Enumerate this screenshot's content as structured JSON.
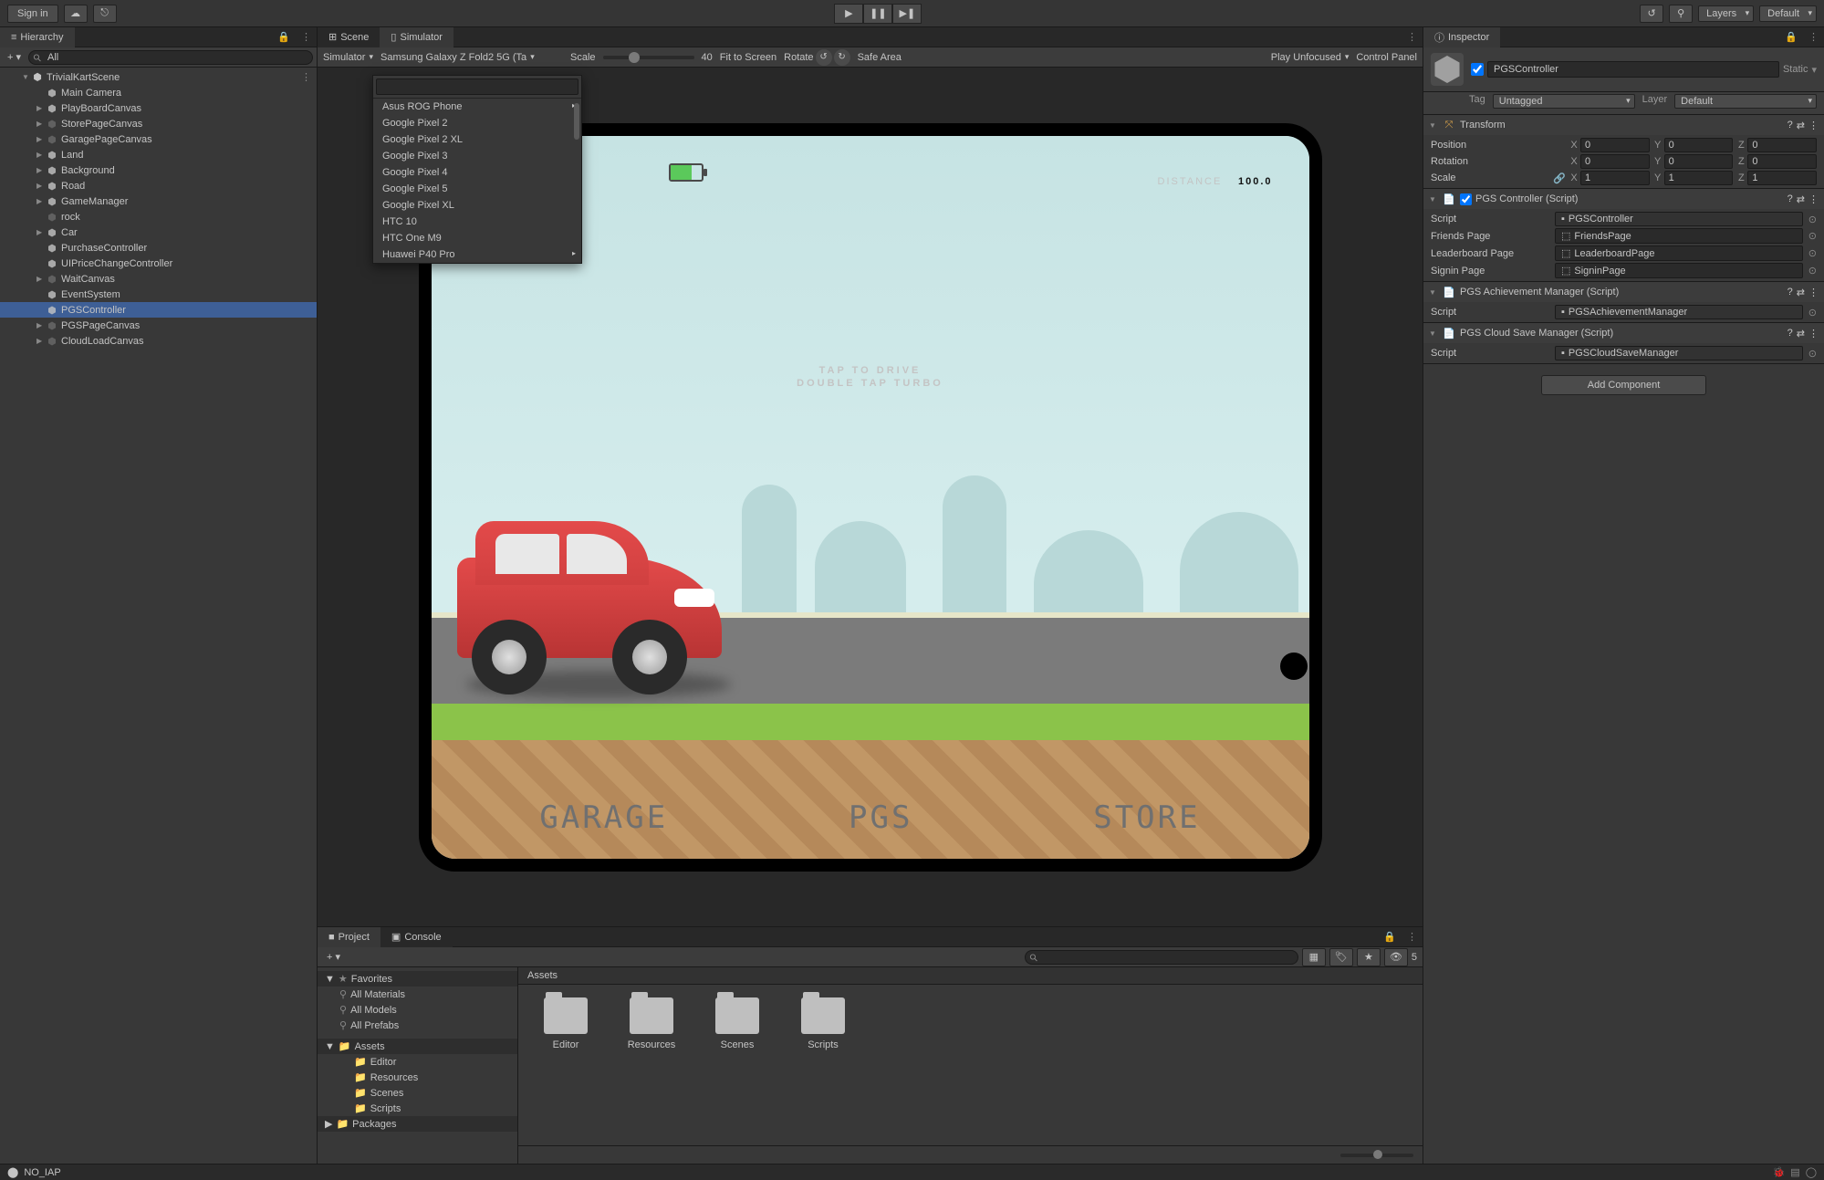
{
  "toolbar": {
    "sign_in": "Sign in",
    "layers": "Layers",
    "layout": "Default"
  },
  "hierarchy": {
    "title": "Hierarchy",
    "search_placeholder": "All",
    "root": "TrivialKartScene",
    "items": [
      {
        "name": "Main Camera",
        "dim": false
      },
      {
        "name": "PlayBoardCanvas",
        "dim": false,
        "exp": true
      },
      {
        "name": "StorePageCanvas",
        "dim": true,
        "exp": true
      },
      {
        "name": "GaragePageCanvas",
        "dim": true,
        "exp": true
      },
      {
        "name": "Land",
        "dim": false,
        "exp": true
      },
      {
        "name": "Background",
        "dim": false,
        "exp": true
      },
      {
        "name": "Road",
        "dim": false,
        "exp": true
      },
      {
        "name": "GameManager",
        "dim": false,
        "exp": true
      },
      {
        "name": "rock",
        "dim": true
      },
      {
        "name": "Car",
        "dim": false,
        "exp": true
      },
      {
        "name": "PurchaseController",
        "dim": false
      },
      {
        "name": "UIPriceChangeController",
        "dim": false
      },
      {
        "name": "WaitCanvas",
        "dim": true,
        "exp": true
      },
      {
        "name": "EventSystem",
        "dim": false
      },
      {
        "name": "PGSController",
        "dim": false,
        "selected": true
      },
      {
        "name": "PGSPageCanvas",
        "dim": true,
        "exp": true
      },
      {
        "name": "CloudLoadCanvas",
        "dim": true,
        "exp": true
      }
    ]
  },
  "tabs": {
    "scene": "Scene",
    "simulator": "Simulator"
  },
  "simulator": {
    "mode": "Simulator",
    "device": "Samsung Galaxy Z Fold2 5G (Ta",
    "scale_label": "Scale",
    "scale_value": "40",
    "fit": "Fit to Screen",
    "rotate": "Rotate",
    "safe": "Safe Area",
    "play_unfocused": "Play Unfocused",
    "control_panel": "Control Panel",
    "device_list": [
      "Asus ROG Phone",
      "Google Pixel 2",
      "Google Pixel 2 XL",
      "Google Pixel 3",
      "Google Pixel 4",
      "Google Pixel 5",
      "Google Pixel XL",
      "HTC 10",
      "HTC One M9",
      "Huawei P40 Pro"
    ]
  },
  "game": {
    "distance_label": "DISTANCE",
    "distance_value": "100.0",
    "line1": "TAP TO DRIVE",
    "line2": "DOUBLE TAP TURBO",
    "btn_garage": "GARAGE",
    "btn_pgs": "PGS",
    "btn_store": "STORE"
  },
  "inspector": {
    "title": "Inspector",
    "name": "PGSController",
    "static": "Static",
    "tag_label": "Tag",
    "tag_value": "Untagged",
    "layer_label": "Layer",
    "layer_value": "Default",
    "transform": {
      "title": "Transform",
      "position": "Position",
      "rotation": "Rotation",
      "scale": "Scale",
      "pos": {
        "x": "0",
        "y": "0",
        "z": "0"
      },
      "rot": {
        "x": "0",
        "y": "0",
        "z": "0"
      },
      "scl": {
        "x": "1",
        "y": "1",
        "z": "1"
      }
    },
    "comp1": {
      "title": "PGS Controller (Script)",
      "script_lbl": "Script",
      "script_val": "PGSController",
      "friends_lbl": "Friends Page",
      "friends_val": "FriendsPage",
      "leader_lbl": "Leaderboard Page",
      "leader_val": "LeaderboardPage",
      "signin_lbl": "Signin Page",
      "signin_val": "SigninPage"
    },
    "comp2": {
      "title": "PGS Achievement Manager (Script)",
      "script_lbl": "Script",
      "script_val": "PGSAchievementManager"
    },
    "comp3": {
      "title": "PGS Cloud Save Manager (Script)",
      "script_lbl": "Script",
      "script_val": "PGSCloudSaveManager"
    },
    "add_component": "Add Component"
  },
  "project": {
    "tab_project": "Project",
    "tab_console": "Console",
    "favorites": "Favorites",
    "fav_items": [
      "All Materials",
      "All Models",
      "All Prefabs"
    ],
    "assets": "Assets",
    "asset_items": [
      "Editor",
      "Resources",
      "Scenes",
      "Scripts"
    ],
    "packages": "Packages",
    "path": "Assets",
    "folders": [
      "Editor",
      "Resources",
      "Scenes",
      "Scripts"
    ],
    "hidden_count": "5"
  },
  "status": {
    "msg": "NO_IAP"
  }
}
